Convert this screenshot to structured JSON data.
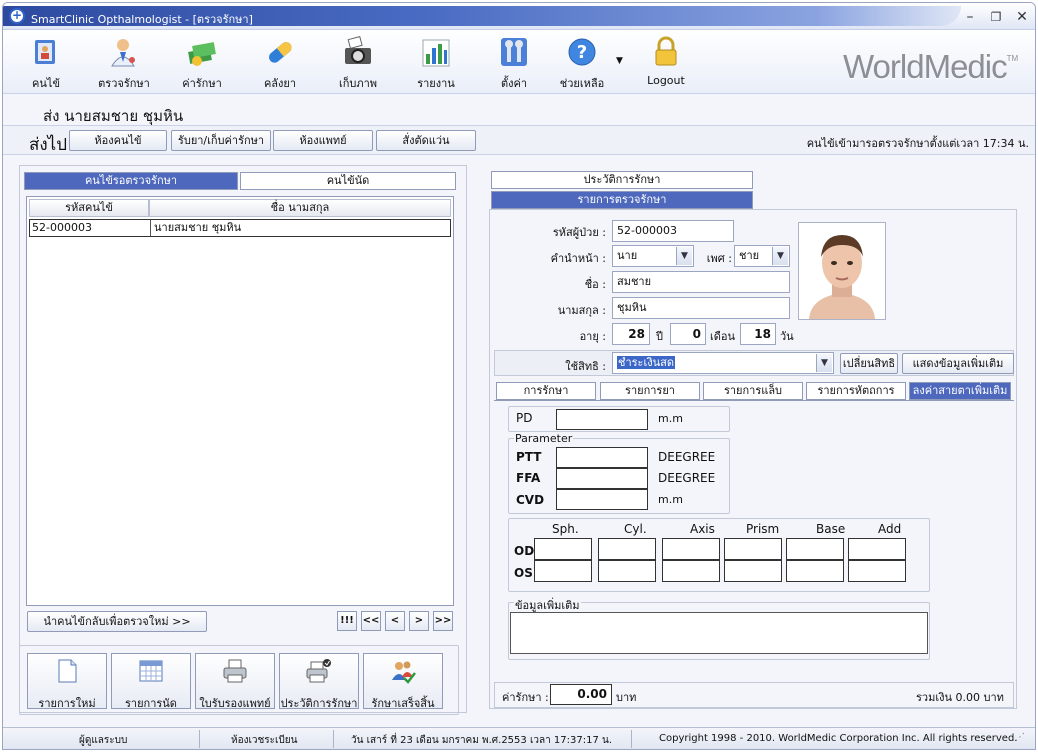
{
  "window": {
    "title": "SmartClinic Opthalmologist - [ตรวจรักษา]"
  },
  "toolbar": {
    "items": [
      {
        "label": "คนไข้",
        "icon": "patient-folder-icon"
      },
      {
        "label": "ตรวจรักษา",
        "icon": "doctor-icon"
      },
      {
        "label": "ค่ารักษา",
        "icon": "money-icon"
      },
      {
        "label": "คลังยา",
        "icon": "capsule-icon"
      },
      {
        "label": "เก็บภาพ",
        "icon": "camera-icon"
      },
      {
        "label": "รายงาน",
        "icon": "bar-chart-icon"
      },
      {
        "label": "ตั้งค่า",
        "icon": "tools-icon"
      },
      {
        "label": "ช่วยเหลือ",
        "icon": "help-icon"
      },
      {
        "label": "Logout",
        "icon": "lock-icon"
      }
    ],
    "logo": "WorldMedic"
  },
  "patient_header": {
    "text": "ส่ง นายสมชาย ชุมหิน"
  },
  "send_row": {
    "label": "ส่งไป",
    "buttons": [
      "ห้องคนไข้",
      "รับยา/เก็บค่ารักษา",
      "ห้องแพทย์",
      "สั่งตัดแว่น"
    ],
    "wait_text": "คนไข้เข้ามารอตรวจรักษาตั้งแต่เวลา 17:34 น."
  },
  "left": {
    "tabs": [
      "คนไข้รอตรวจรักษา",
      "คนไข้นัด"
    ],
    "columns": [
      "รหัสคนไข้",
      "ชื่อ นามสกุล"
    ],
    "rows": [
      {
        "id": "52-000003",
        "name": "นายสมชาย ชุมหิน"
      }
    ],
    "return_button": "นำคนไข้กลับเพื่อตรวจใหม่ >>",
    "nav": [
      "!!!",
      "<<",
      "<",
      ">",
      ">>"
    ],
    "actions": [
      {
        "label": "รายการใหม่",
        "icon": "new-document-icon"
      },
      {
        "label": "รายการนัด",
        "icon": "calendar-icon"
      },
      {
        "label": "ใบรับรองแพทย์",
        "icon": "printer-icon"
      },
      {
        "label": "ประวัติการรักษา",
        "icon": "printer-check-icon"
      },
      {
        "label": "รักษาเสร็จสิ้น",
        "icon": "users-check-icon"
      }
    ]
  },
  "right": {
    "tabs": [
      "ประวัติการรักษา",
      "รายการตรวจรักษา"
    ],
    "fields": {
      "patient_id_label": "รหัสผู้ป่วย :",
      "patient_id": "52-000003",
      "prefix_label": "คำนำหน้า :",
      "prefix": "นาย",
      "sex_label": "เพศ :",
      "sex": "ชาย",
      "first_name_label": "ชื่อ :",
      "first_name": "สมชาย",
      "last_name_label": "นามสกุล :",
      "last_name": "ชุมหิน",
      "age_label": "อายุ :",
      "age_years": "28",
      "years_unit": "ปี",
      "age_months": "0",
      "months_unit": "เดือน",
      "age_days": "18",
      "days_unit": "วัน",
      "rights_label": "ใช้สิทธิ :",
      "rights": "ชำระเงินสด",
      "change_rights_button": "เปลี่ยนสิทธิ",
      "more_info_button": "แสดงข้อมูลเพิ่มเติม"
    },
    "sub_tabs": [
      "การรักษา",
      "รายการยา",
      "รายการแล็บ",
      "รายการหัตถการ",
      "ลงค่าสายตาเพิ่มเติม"
    ],
    "eye": {
      "pd_label": "PD",
      "pd_unit": "m.m",
      "parameter_title": "Parameter",
      "params": [
        {
          "label": "PTT",
          "unit": "DEEGREE"
        },
        {
          "label": "FFA",
          "unit": "DEEGREE"
        },
        {
          "label": "CVD",
          "unit": "m.m"
        }
      ],
      "rx_columns": [
        "Sph.",
        "Cyl.",
        "Axis",
        "Prism",
        "Base",
        "Add"
      ],
      "rx_rows": [
        "OD",
        "OS"
      ],
      "extra_title": "ข้อมูลเพิ่มเติม"
    },
    "fee_label": "ค่ารักษา :",
    "fee_value": "0.00",
    "fee_unit": "บาท",
    "total": "รวมเงิน 0.00 บาท"
  },
  "status": {
    "user": "ผู้ดูแลระบบ",
    "room": "ห้องเวชระเบียน",
    "datetime": "วัน เสาร์ ที่ 23 เดือน มกราคม พ.ศ.2553 เวลา 17:37:17 น.",
    "copyright": "Copyright 1998 - 2010. WorldMedic Corporation Inc. All rights reserved."
  }
}
